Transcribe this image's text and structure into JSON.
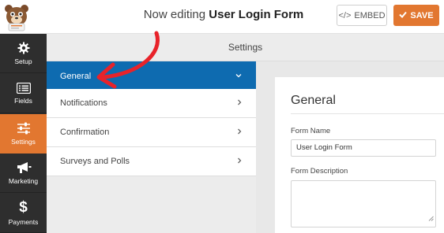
{
  "header": {
    "logo_icon": "bear-mascot-logo",
    "title_prefix": "Now editing",
    "title_name": "User Login Form",
    "embed_label": "EMBED",
    "embed_icon": "code-brackets-icon",
    "save_label": "SAVE",
    "save_icon": "checkmark-icon"
  },
  "sidebar": {
    "items": [
      {
        "label": "Setup",
        "icon": "gear-icon"
      },
      {
        "label": "Fields",
        "icon": "list-icon"
      },
      {
        "label": "Settings",
        "icon": "sliders-icon",
        "active": true
      },
      {
        "label": "Marketing",
        "icon": "megaphone-icon"
      },
      {
        "label": "Payments",
        "icon": "dollar-icon"
      }
    ]
  },
  "settings_header": "Settings",
  "settings_menu": {
    "items": [
      {
        "label": "General",
        "active": true
      },
      {
        "label": "Notifications"
      },
      {
        "label": "Confirmation"
      },
      {
        "label": "Surveys and Polls"
      }
    ]
  },
  "panel": {
    "title": "General",
    "form_name_label": "Form Name",
    "form_name_value": "User Login Form",
    "form_description_label": "Form Description",
    "form_description_value": ""
  },
  "colors": {
    "accent": "#e27730",
    "active_blue": "#0e6bb0",
    "sidebar_dark": "#2e2e2e",
    "arrow_red": "#e8232a"
  }
}
